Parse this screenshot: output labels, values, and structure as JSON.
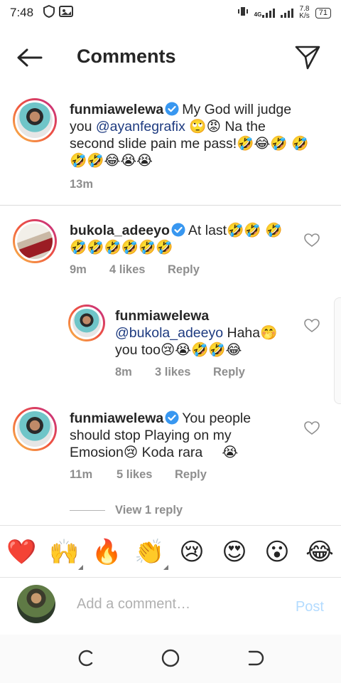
{
  "status_bar": {
    "time": "7:48",
    "network_type": "4G",
    "net_speed_value": "7.8",
    "net_speed_unit": "K/s",
    "battery": "71"
  },
  "header": {
    "title": "Comments"
  },
  "comments": [
    {
      "username": "funmiawelewa",
      "verified": true,
      "text_parts": [
        "My God will judge you ",
        "@ayanfegrafix",
        " 🙄😡 Na the second slide pain me pass!🤣😂🤣 🤣🤣🤣😂😭😭"
      ],
      "time": "13m"
    },
    {
      "username": "bukola_adeeyo",
      "verified": true,
      "text": "At last🤣🤣 🤣🤣🤣🤣🤣🤣🤣",
      "time": "9m",
      "likes": "4 likes",
      "reply_label": "Reply"
    },
    {
      "username": "funmiawelewa",
      "verified": false,
      "mention": "@bukola_adeeyo",
      "text": " Haha🤭 you too😢😭🤣🤣😂",
      "time": "8m",
      "likes": "3 likes",
      "reply_label": "Reply"
    },
    {
      "username": "funmiawelewa",
      "verified": true,
      "text": "You people should stop Playing on my Emosion😢 Koda rara     😭",
      "time": "11m",
      "likes": "5 likes",
      "reply_label": "Reply",
      "view_replies": "View 1 reply"
    }
  ],
  "quick_emojis": [
    "❤️",
    "🙌",
    "🔥",
    "👏",
    "😢",
    "😍",
    "😮",
    "😂"
  ],
  "add_comment": {
    "placeholder": "Add a comment…",
    "post_label": "Post"
  },
  "colors": {
    "mention": "#1e3b80",
    "verified": "#3897f0",
    "post_disabled": "#b3dbff",
    "meta": "#8e8e8e"
  }
}
